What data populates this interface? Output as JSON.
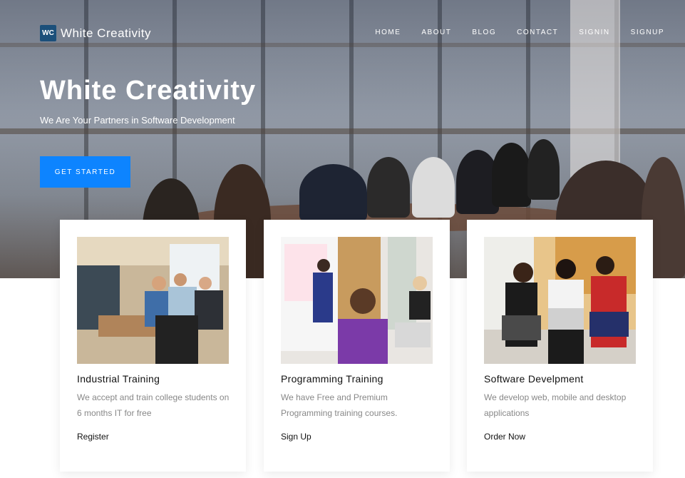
{
  "brand": {
    "logo_text": "WC",
    "name": "White Creativity"
  },
  "nav": {
    "items": [
      "HOME",
      "ABOUT",
      "BLOG",
      "CONTACT",
      "SIGNIN",
      "SIGNUP"
    ]
  },
  "hero": {
    "title_light": "White",
    "title_bold": "Creativity",
    "subtitle": "We Are Your Partners in Software Development",
    "cta_label": "GET STARTED"
  },
  "cards": [
    {
      "title": "Industrial Training",
      "description": "We accept and train college students on 6 months IT for free",
      "link": "Register"
    },
    {
      "title": "Programming Training",
      "description": "We have Free and Premium Programming training courses.",
      "link": "Sign Up"
    },
    {
      "title": "Software Develpment",
      "description": "We develop web, mobile and desktop applications",
      "link": "Order Now"
    }
  ],
  "colors": {
    "accent": "#0d84ff",
    "logo_bg": "#1b4f7a"
  }
}
